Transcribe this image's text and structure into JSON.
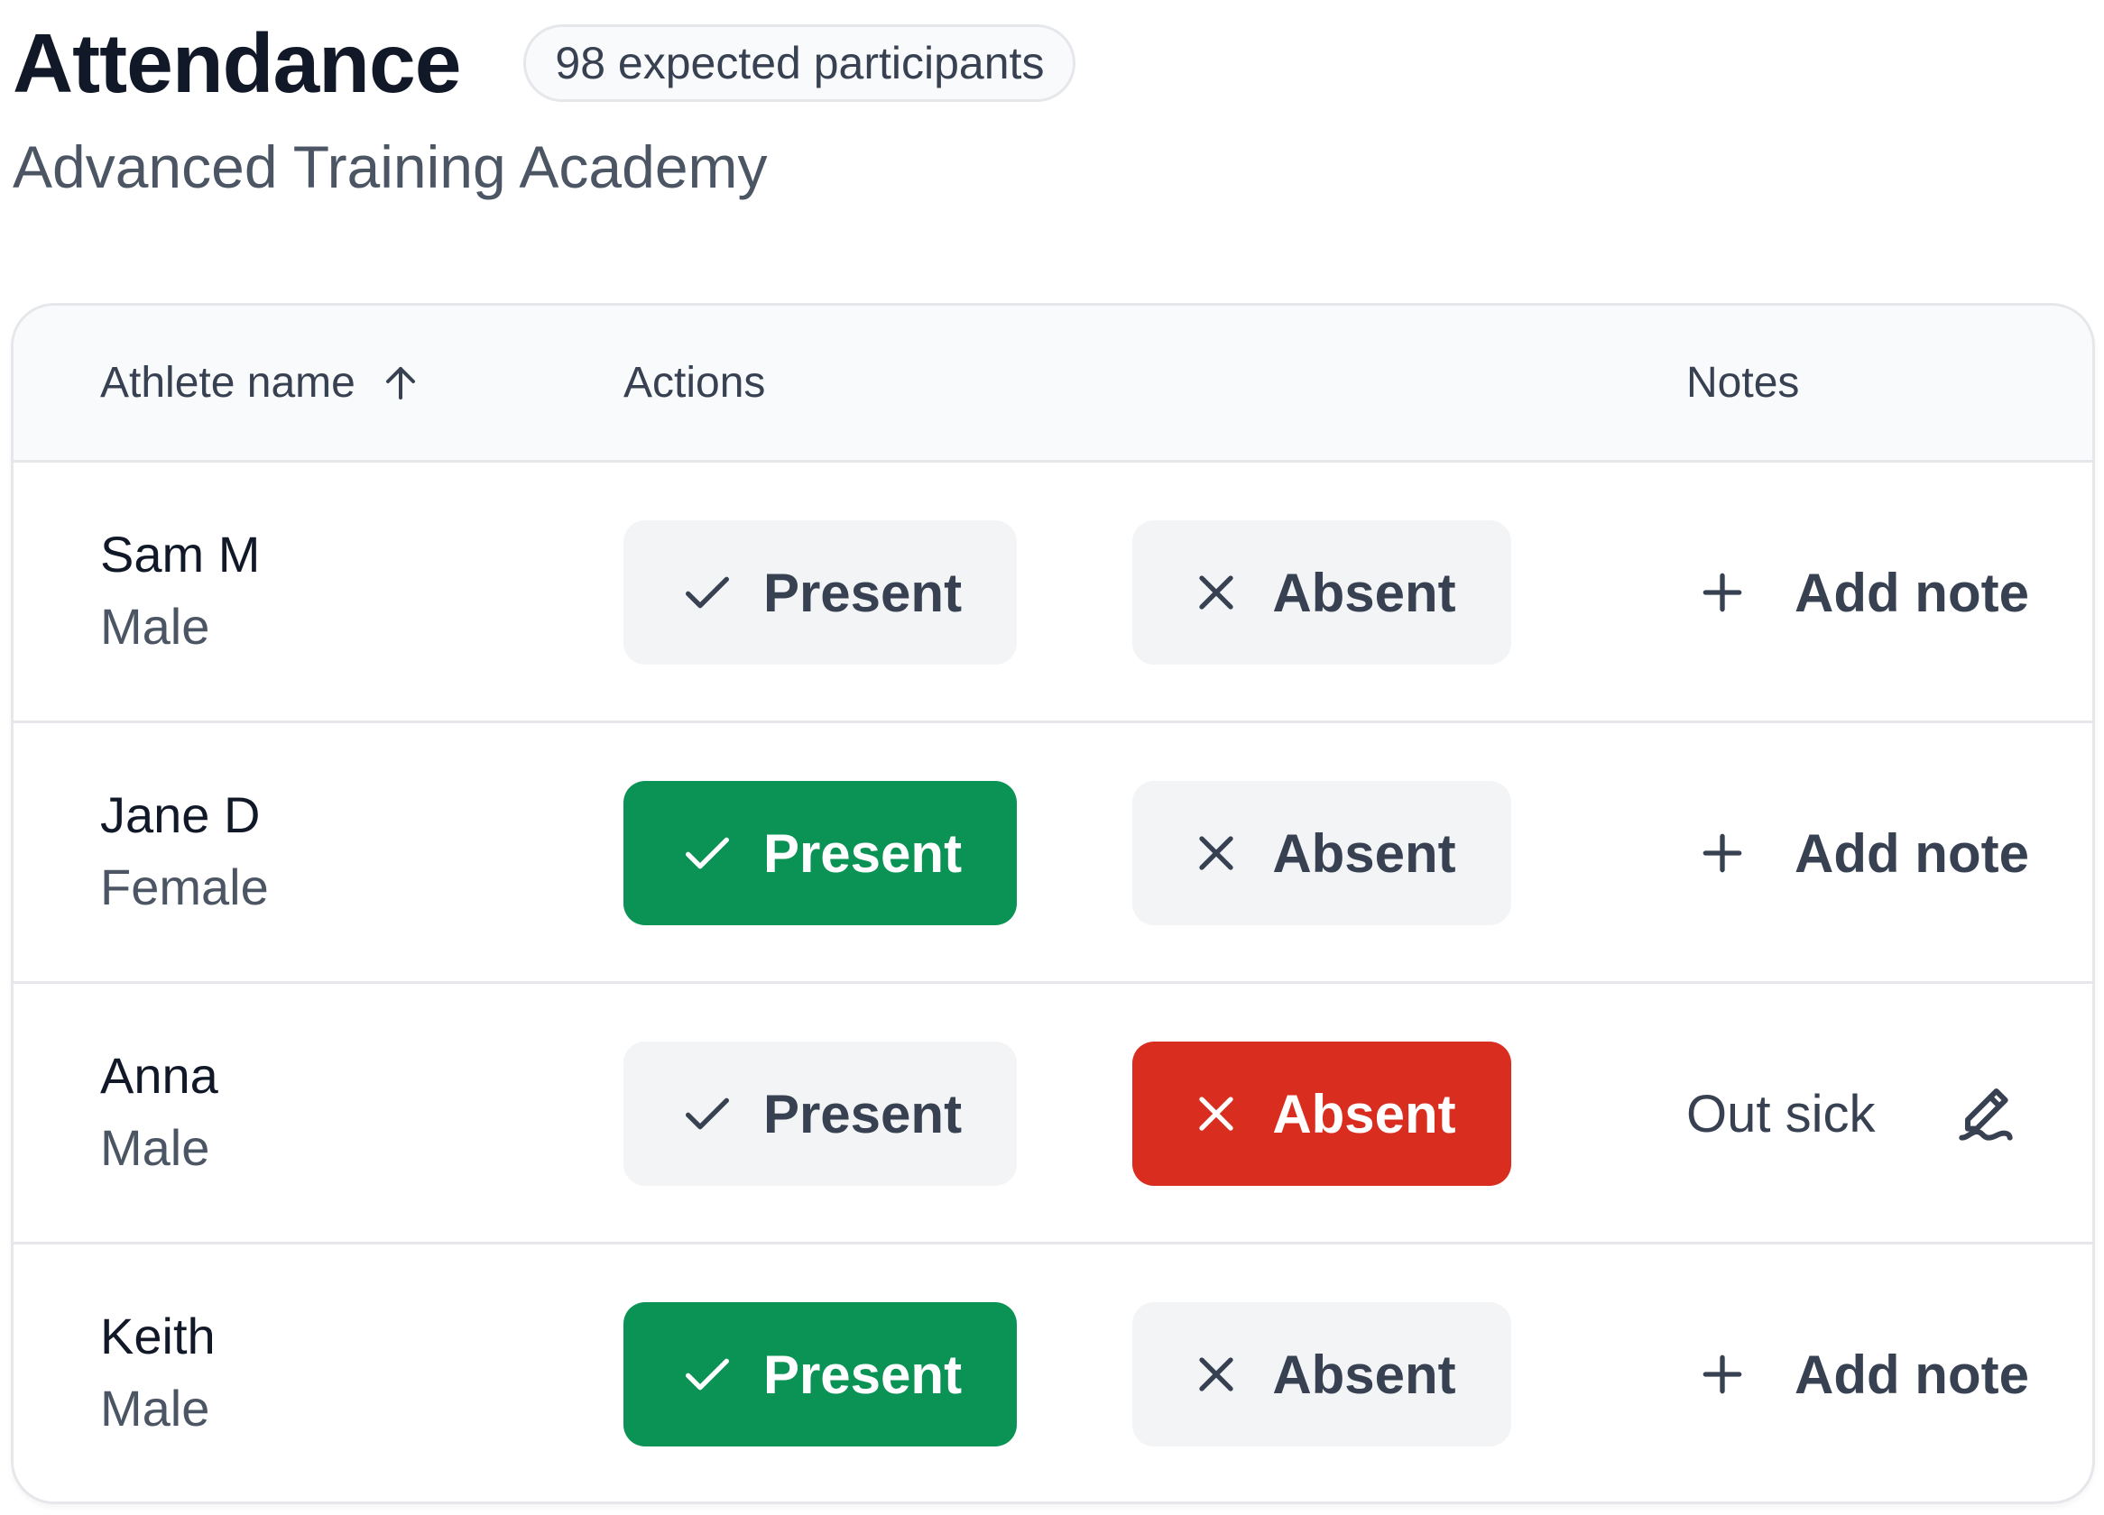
{
  "header": {
    "title": "Attendance",
    "badge": "98 expected participants",
    "subtitle": "Advanced Training Academy"
  },
  "table": {
    "columns": {
      "name": "Athlete name",
      "actions": "Actions",
      "notes": "Notes"
    },
    "sort_icon": "arrow-up-icon",
    "present_label": "Present",
    "absent_label": "Absent",
    "add_note_label": "Add note",
    "rows": [
      {
        "name": "Sam M",
        "gender": "Male",
        "status": "none",
        "note": ""
      },
      {
        "name": "Jane D",
        "gender": "Female",
        "status": "present",
        "note": ""
      },
      {
        "name": "Anna",
        "gender": "Male",
        "status": "absent",
        "note": "Out sick"
      },
      {
        "name": "Keith",
        "gender": "Male",
        "status": "present",
        "note": ""
      }
    ]
  },
  "colors": {
    "present_active": "#0a9354",
    "absent_active": "#d92d20",
    "button_inactive": "#f3f4f6",
    "text_primary": "#111827",
    "text_secondary": "#4b5563"
  }
}
